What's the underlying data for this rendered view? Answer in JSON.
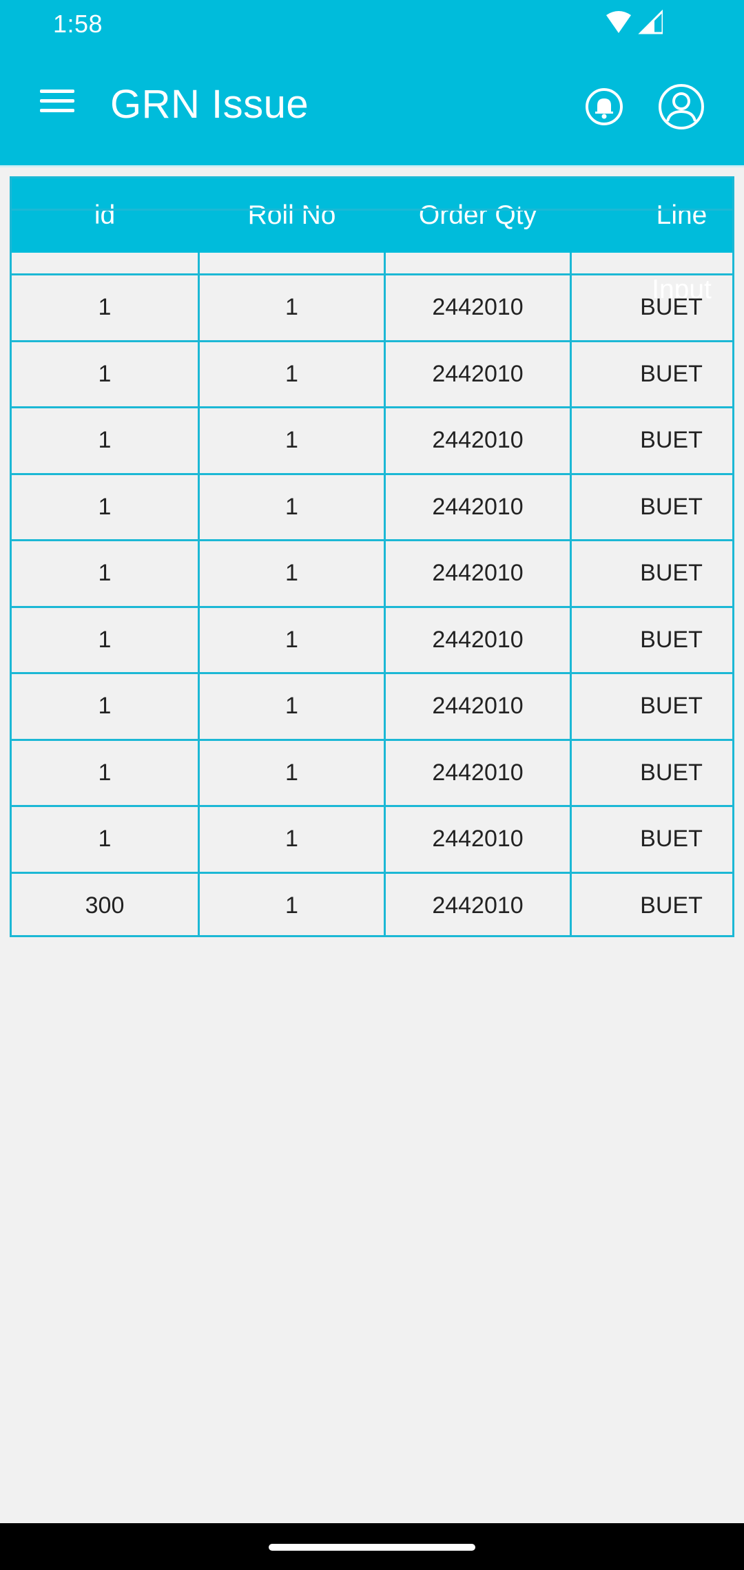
{
  "status_bar": {
    "time": "1:58"
  },
  "app_bar": {
    "title": "GRN Issue"
  },
  "table": {
    "columns": [
      "id",
      "Roll No",
      "Order Qty",
      "Line Input"
    ],
    "rows": [
      [
        "1",
        "1",
        "2442010",
        "BUET"
      ],
      [
        "1",
        "1",
        "2442010",
        "BUET"
      ],
      [
        "1",
        "1",
        "2442010",
        "BUET"
      ],
      [
        "1",
        "1",
        "2442010",
        "BUET"
      ],
      [
        "1",
        "1",
        "2442010",
        "BUET"
      ],
      [
        "1",
        "1",
        "2442010",
        "BUET"
      ],
      [
        "1",
        "1",
        "2442010",
        "BUET"
      ],
      [
        "1",
        "1",
        "2442010",
        "BUET"
      ],
      [
        "1",
        "1",
        "2442010",
        "BUET"
      ],
      [
        "300",
        "1",
        "2442010",
        "BUET"
      ]
    ]
  },
  "colors": {
    "primary": "#00bcdb",
    "grid": "#1cb8d5",
    "background": "#f1f1f1"
  },
  "icons": [
    "wifi-icon",
    "signal-icon",
    "menu-icon",
    "bell-icon",
    "account-icon"
  ]
}
